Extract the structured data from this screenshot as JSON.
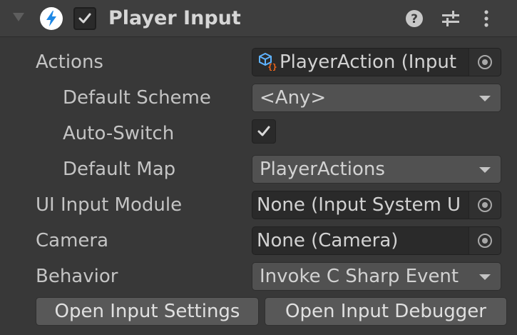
{
  "component": {
    "title": "Player Input",
    "enabled": true,
    "icons": {
      "foldout": "foldout-arrow-icon",
      "component": "lightning-bolt-icon",
      "help": "help-icon",
      "presets": "presets-sliders-icon",
      "menu": "kebab-menu-icon"
    }
  },
  "fields": {
    "actions": {
      "label": "Actions",
      "value": "PlayerAction (Input"
    },
    "default_scheme": {
      "label": "Default Scheme",
      "value": "<Any>"
    },
    "auto_switch": {
      "label": "Auto-Switch",
      "checked": true
    },
    "default_map": {
      "label": "Default Map",
      "value": "PlayerActions"
    },
    "ui_input_module": {
      "label": "UI Input Module",
      "value": "None (Input System U"
    },
    "camera": {
      "label": "Camera",
      "value": "None (Camera)"
    },
    "behavior": {
      "label": "Behavior",
      "value": "Invoke C Sharp Event"
    }
  },
  "buttons": {
    "open_settings": "Open Input Settings",
    "open_debugger": "Open Input Debugger"
  },
  "colors": {
    "background": "#383838",
    "header": "#3e3e3e",
    "field": "#2a2a2a",
    "dropdown": "#515151",
    "button": "#585858",
    "accent": "#1e88e5",
    "asset_orange": "#ff6a1a"
  }
}
